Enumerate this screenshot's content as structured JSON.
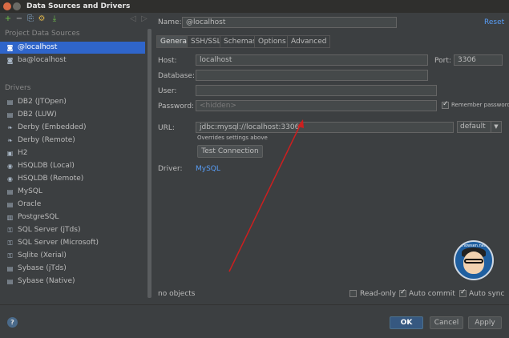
{
  "window": {
    "title": "Data Sources and Drivers"
  },
  "toolbar": {
    "add": "+",
    "remove": "−",
    "copy": "⎘",
    "settings": "⚙",
    "import": "⤓",
    "back": "◁",
    "forward": "▷"
  },
  "left": {
    "project_section": "Project Data Sources",
    "project_items": [
      {
        "label": "@localhost",
        "selected": true
      },
      {
        "label": "ba@localhost",
        "selected": false
      }
    ],
    "drivers_section": "Drivers",
    "drivers": [
      "DB2 (JTOpen)",
      "DB2 (LUW)",
      "Derby (Embedded)",
      "Derby (Remote)",
      "H2",
      "HSQLDB (Local)",
      "HSQLDB (Remote)",
      "MySQL",
      "Oracle",
      "PostgreSQL",
      "SQL Server (jTds)",
      "SQL Server (Microsoft)",
      "Sqlite (Xerial)",
      "Sybase (jTds)",
      "Sybase (Native)"
    ]
  },
  "form": {
    "name_label": "Name:",
    "name_value": "@localhost",
    "reset": "Reset",
    "tabs": [
      "General",
      "SSH/SSL",
      "Schemas",
      "Options",
      "Advanced"
    ],
    "host_label": "Host:",
    "host_value": "localhost",
    "port_label": "Port:",
    "port_value": "3306",
    "database_label": "Database:",
    "database_value": "",
    "user_label": "User:",
    "user_value": "",
    "password_label": "Password:",
    "password_value": "<hidden>",
    "remember_password": "Remember password",
    "url_label": "URL:",
    "url_value": "jdbc:mysql://localhost:3306",
    "url_mode": "default",
    "overrides": "Overrides settings above",
    "test_connection": "Test Connection",
    "driver_label": "Driver:",
    "driver_value": "MySQL",
    "objects_status": "no objects",
    "readonly": "Read-only",
    "auto_commit": "Auto commit",
    "auto_sync": "Auto sync"
  },
  "buttons": {
    "help": "?",
    "ok": "OK",
    "cancel": "Cancel",
    "apply": "Apply"
  },
  "watermark": {
    "text": "Howsen.net"
  },
  "colors": {
    "selection": "#2f65ca",
    "link": "#589df6",
    "annotation": "#cc1f1f",
    "primary_button": "#365880"
  }
}
